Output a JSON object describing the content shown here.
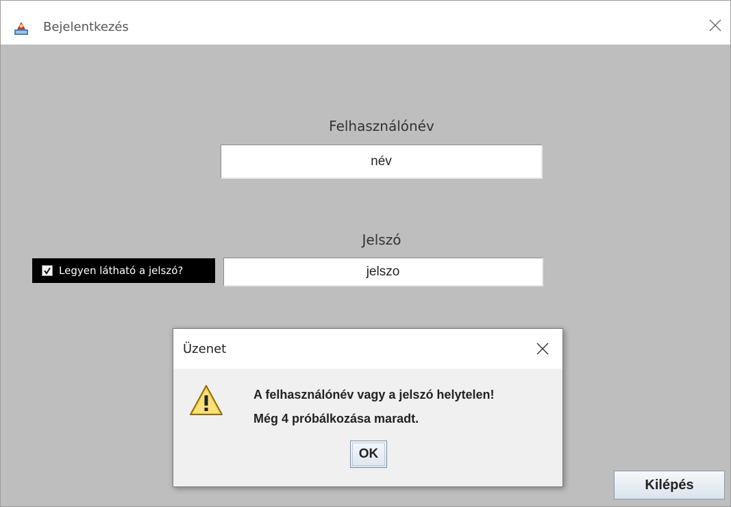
{
  "window": {
    "title": "Bejelentkezés",
    "background": "#bebebe"
  },
  "form": {
    "username_label": "Felhasználónév",
    "username_value": "név",
    "password_label": "Jelszó",
    "password_value": "jelszo",
    "show_password_label": "Legyen látható a jelszó?",
    "show_password_checked": true
  },
  "dialog": {
    "title": "Üzenet",
    "icon": "warning-icon",
    "message_line1": "A felhasználónév vagy a jelszó helytelen!",
    "message_line2": "Még 4 próbálkozása maradt.",
    "ok_label": "OK"
  },
  "footer": {
    "exit_label": "Kilépés"
  }
}
